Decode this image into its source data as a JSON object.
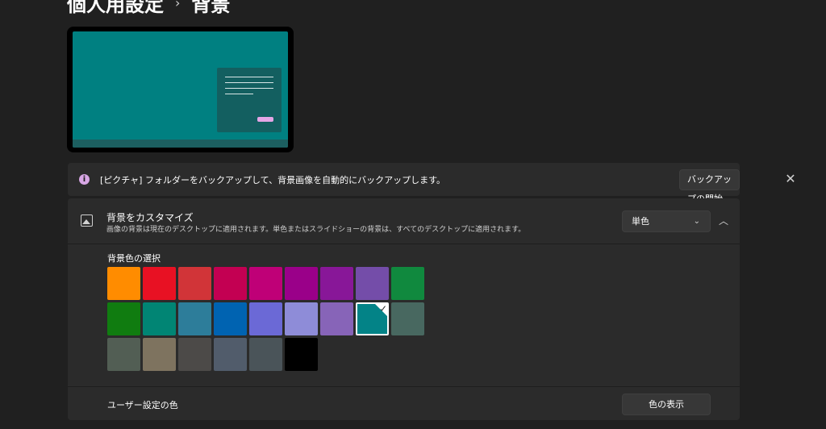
{
  "breadcrumb": {
    "parent": "個人用設定",
    "separator": "›",
    "current": "背景"
  },
  "banner": {
    "icon": "info-icon",
    "text": "[ピクチャ] フォルダーをバックアップして、背景画像を自動的にバックアップします。",
    "button_label": "バックアップの開始",
    "close_glyph": "✕"
  },
  "customize": {
    "title": "背景をカスタマイズ",
    "subtitle": "画像の背景は現在のデスクトップに適用されます。単色またはスライドショーの背景は、すべてのデスクトップに適用されます。",
    "select_value": "単色",
    "chevron_glyph": "⌄",
    "collapse_glyph": "︿",
    "color_label": "背景色の選択",
    "swatches": [
      [
        "#ff8c00",
        "#e81123",
        "#d13438",
        "#c30052",
        "#bf0077",
        "#9a0089",
        "#881798",
        "#744da9",
        "#10893e"
      ],
      [
        "#107c10",
        "#018574",
        "#2d7d9a",
        "#0063b1",
        "#6b69d6",
        "#8e8cd8",
        "#8764b8",
        "#038387",
        "#486860"
      ],
      [
        "#525e54",
        "#7e735f",
        "#4c4a48",
        "#515c6b",
        "#4a5459",
        "#000000"
      ]
    ],
    "selected_color": "#038387",
    "custom_label": "ユーザー設定の色",
    "show_color_button": "色の表示"
  },
  "colors": {
    "accent_info": "#d7a6e4",
    "preview_desktop": "#008081"
  }
}
